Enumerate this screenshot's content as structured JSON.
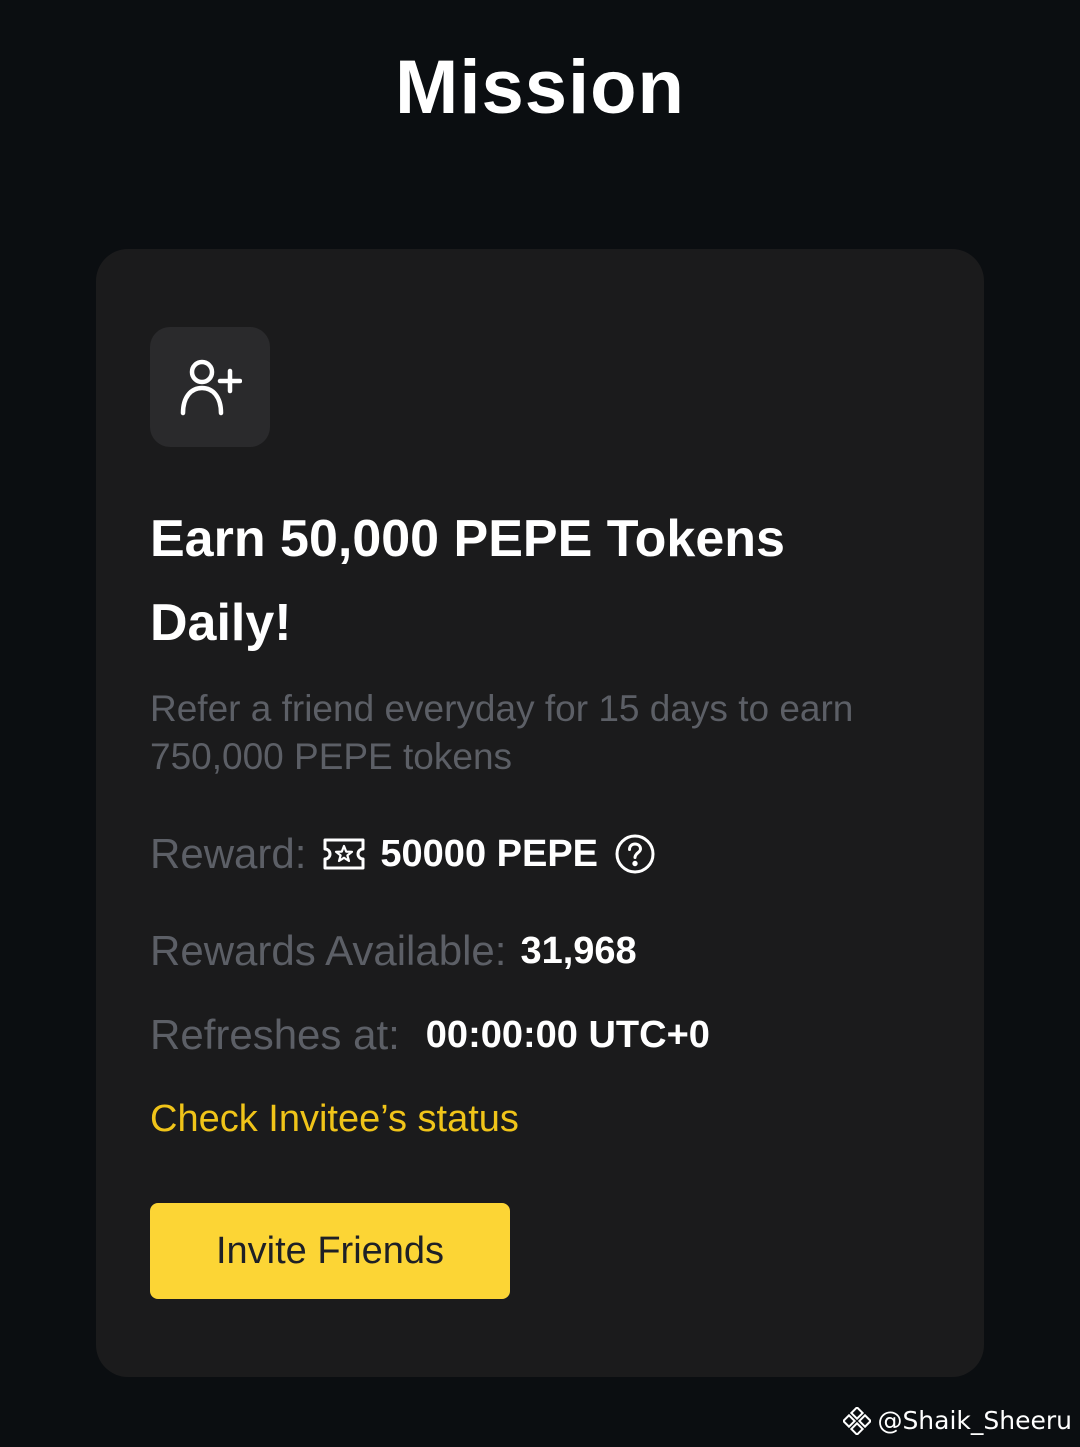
{
  "header": {
    "title": "Mission"
  },
  "card": {
    "icon": "add-user-icon",
    "title": "Earn 50,000 PEPE Tokens Daily!",
    "description": "Refer a friend everyday for 15 days to earn 750,000 PEPE tokens",
    "reward": {
      "label": "Reward:",
      "icon": "ticket-icon",
      "value": "50000 PEPE",
      "help_icon": "question-circle-icon"
    },
    "rewards_available": {
      "label": "Rewards Available:",
      "value": "31,968"
    },
    "refresh": {
      "label": "Refreshes at:",
      "value": "00:00:00 UTC+0"
    },
    "status_link": "Check Invitee’s status",
    "invite_button": "Invite Friends"
  },
  "watermark": {
    "icon": "binance-logo-icon",
    "text": "@Shaik_Sheeru"
  },
  "colors": {
    "background": "#0b0e11",
    "card": "#1b1b1c",
    "accent": "#fcd535",
    "link": "#f0c419",
    "muted_text": "#5c5f66"
  }
}
